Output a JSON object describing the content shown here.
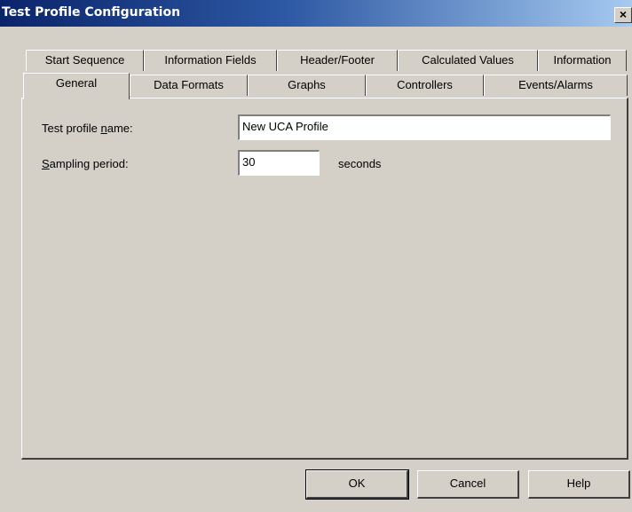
{
  "window": {
    "title": "Test Profile Configuration",
    "close_glyph": "×"
  },
  "tabs_back": [
    "Start Sequence",
    "Information Fields",
    "Header/Footer",
    "Calculated Values",
    "Information"
  ],
  "tabs_front": [
    "General",
    "Data Formats",
    "Graphs",
    "Controllers",
    "Events/Alarms"
  ],
  "form": {
    "profile_name_label_pre": "Test profile ",
    "profile_name_label_u": "n",
    "profile_name_label_post": "ame:",
    "profile_name_value": "New UCA Profile",
    "sampling_label_u": "S",
    "sampling_label_post": "ampling period:",
    "sampling_value": "30",
    "sampling_unit": "seconds"
  },
  "buttons": {
    "ok": "OK",
    "cancel": "Cancel",
    "help": "Help"
  }
}
